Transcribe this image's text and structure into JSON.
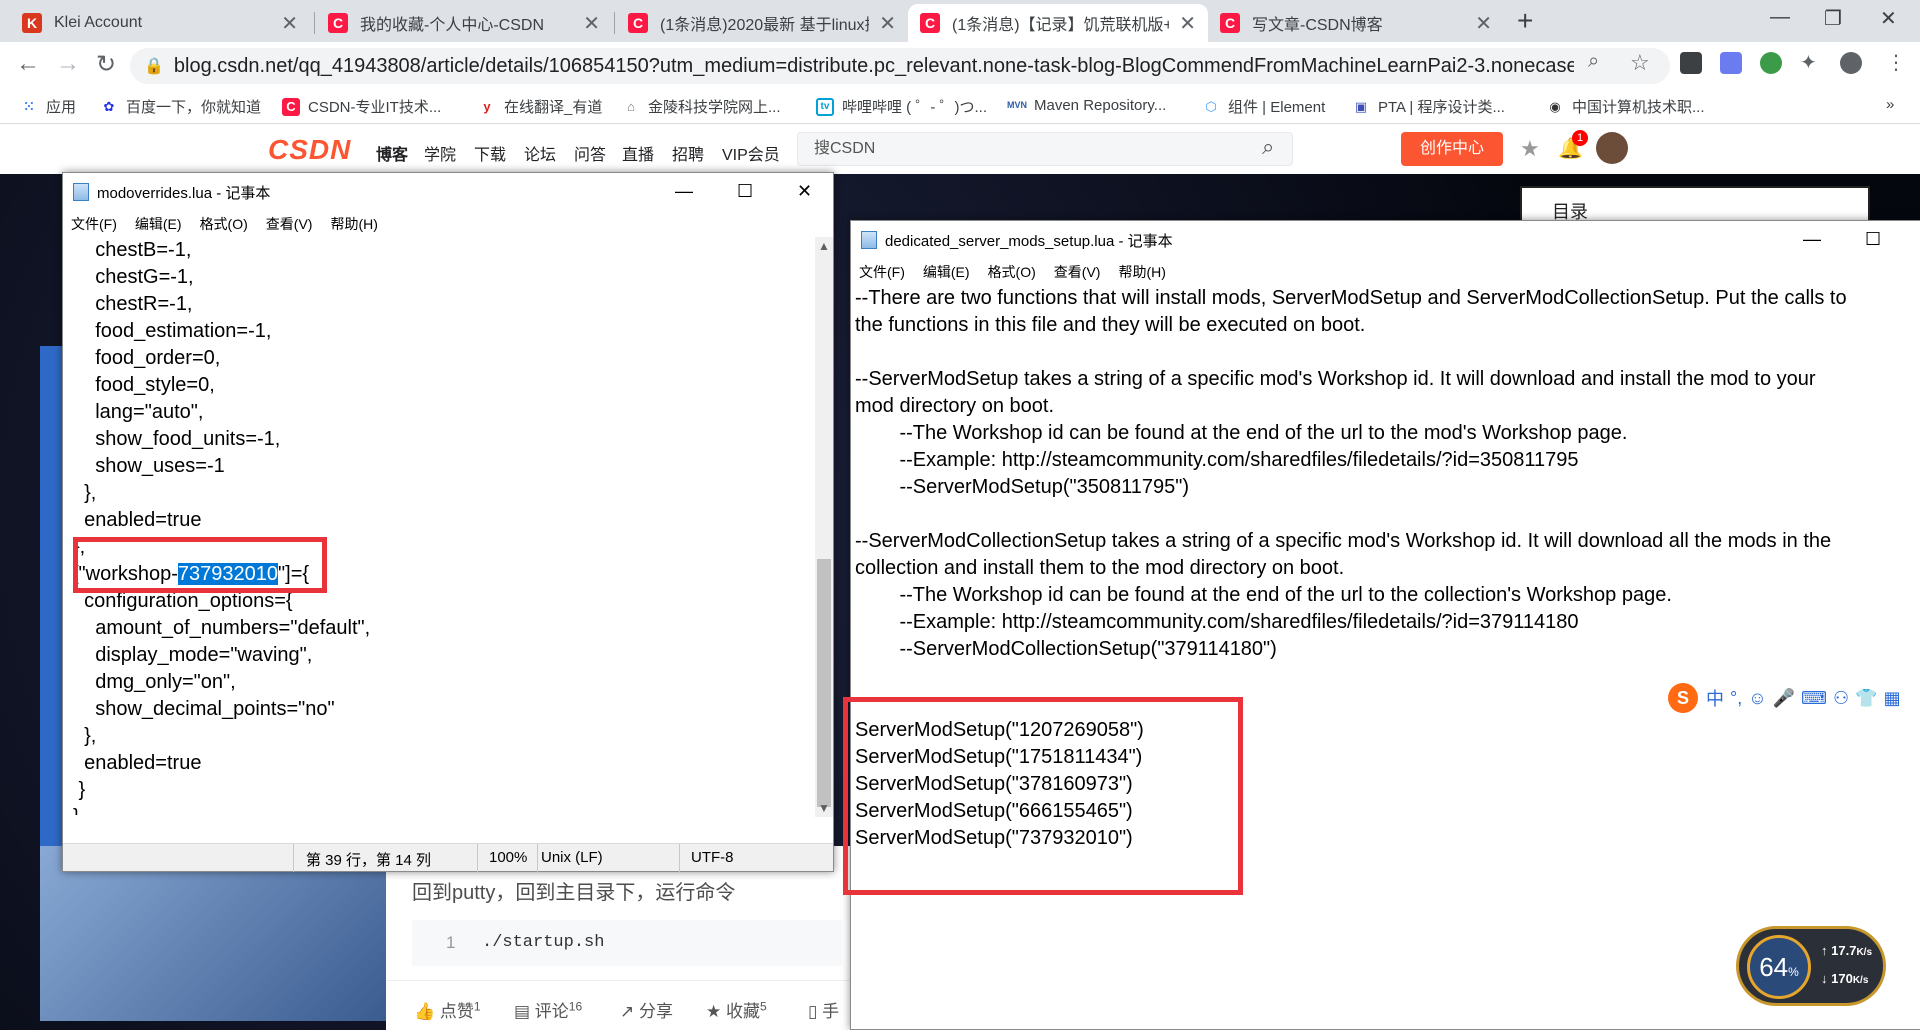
{
  "browser": {
    "tabs": [
      {
        "label": "Klei Account",
        "favicon": "K"
      },
      {
        "label": "我的收藏-个人中心-CSDN",
        "favicon": "C"
      },
      {
        "label": "(1条消息)2020最新 基于linux搭",
        "favicon": "C"
      },
      {
        "label": "(1条消息)【记录】饥荒联机版+",
        "favicon": "C"
      },
      {
        "label": "写文章-CSDN博客",
        "favicon": "C"
      }
    ],
    "url": "blog.csdn.net/qq_41943808/article/details/106854150?utm_medium=distribute.pc_relevant.none-task-blog-BlogCommendFromMachineLearnPai2-3.nonecase&dep...",
    "bookmarks": [
      {
        "label": "应用",
        "icon": "apps-grid-icon"
      },
      {
        "label": "百度一下，你就知道",
        "icon": "baidu-paw-icon"
      },
      {
        "label": "CSDN-专业IT技术...",
        "icon": "csdn-icon"
      },
      {
        "label": "在线翻译_有道",
        "icon": "youdao-icon"
      },
      {
        "label": "金陵科技学院网上...",
        "icon": "house-icon"
      },
      {
        "label": "哔哩哔哩 ( ゜- ゜)つ...",
        "icon": "bilibili-icon"
      },
      {
        "label": "Maven Repository...",
        "icon": "maven-icon"
      },
      {
        "label": "组件 | Element",
        "icon": "element-icon"
      },
      {
        "label": "PTA | 程序设计类...",
        "icon": "pta-icon"
      },
      {
        "label": "中国计算机技术职...",
        "icon": "globe-icon"
      }
    ]
  },
  "csdn": {
    "logo": "CSDN",
    "nav": [
      "博客",
      "学院",
      "下载",
      "论坛",
      "问答",
      "直播",
      "招聘",
      "VIP会员"
    ],
    "search_placeholder": "搜CSDN",
    "create_label": "创作中心",
    "notif_count": "1",
    "toc_label": "目录",
    "blog_text": "回到putty，回到主目录下，运行命令",
    "code_line_no": "1",
    "code": "./startup.sh",
    "actions": [
      {
        "label": "点赞",
        "count": "1"
      },
      {
        "label": "评论",
        "count": "16"
      },
      {
        "label": "分享",
        "count": ""
      },
      {
        "label": "收藏",
        "count": "5"
      },
      {
        "label": "手",
        "count": ""
      }
    ]
  },
  "notepad_left": {
    "title": "modoverrides.lua - 记事本",
    "menu": [
      "文件(F)",
      "编辑(E)",
      "格式(O)",
      "查看(V)",
      "帮助(H)"
    ],
    "lines_before": "    chestB=-1,\n    chestG=-1,\n    chestR=-1,\n    food_estimation=-1,\n    food_order=0,\n    food_style=0,\n    lang=\"auto\",\n    show_food_units=-1,\n    show_uses=-1\n  },\n  enabled=true\n},",
    "workshop_prefix": "[\"workshop-",
    "workshop_id": "737932010",
    "workshop_suffix": "\"]={",
    "lines_after": "  configuration_options={\n    amount_of_numbers=\"default\",\n    display_mode=\"waving\",\n    dmg_only=\"on\",\n    show_decimal_points=\"no\"\n  },\n  enabled=true\n }\n}",
    "status": {
      "position": "第 39 行，第 14 列",
      "zoom": "100%",
      "eol": "Unix (LF)",
      "encoding": "UTF-8"
    }
  },
  "notepad_right": {
    "title": "dedicated_server_mods_setup.lua - 记事本",
    "menu": [
      "文件(F)",
      "编辑(E)",
      "格式(O)",
      "查看(V)",
      "帮助(H)"
    ],
    "comments": "--There are two functions that will install mods, ServerModSetup and ServerModCollectionSetup. Put the calls to\nthe functions in this file and they will be executed on boot.\n\n--ServerModSetup takes a string of a specific mod's Workshop id. It will download and install the mod to your\nmod directory on boot.\n        --The Workshop id can be found at the end of the url to the mod's Workshop page.\n        --Example: http://steamcommunity.com/sharedfiles/filedetails/?id=350811795\n        --ServerModSetup(\"350811795\")\n\n--ServerModCollectionSetup takes a string of a specific mod's Workshop id. It will download all the mods in the\ncollection and install them to the mod directory on boot.\n        --The Workshop id can be found at the end of the url to the collection's Workshop page.\n        --Example: http://steamcommunity.com/sharedfiles/filedetails/?id=379114180\n        --ServerModCollectionSetup(\"379114180\")",
    "setup_calls": "ServerModSetup(\"1207269058\")\nServerModSetup(\"1751811434\")\nServerModSetup(\"378160973\")\nServerModSetup(\"666155465\")\nServerModSetup(\"737932010\")"
  },
  "ime": {
    "label": "中",
    "punct": "°,"
  },
  "speed": {
    "percent": "64",
    "up": "17.7",
    "down": "170",
    "unit": "K/s"
  },
  "colors": {
    "csdn_red": "#fc5531",
    "highlight_box": "#e8333a",
    "selection": "#0078d7"
  }
}
